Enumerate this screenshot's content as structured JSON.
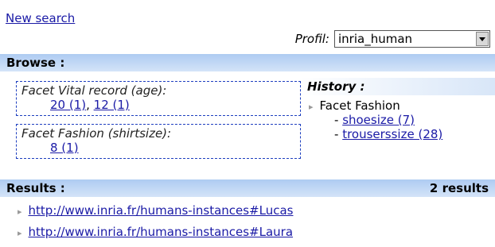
{
  "top": {
    "new_search_label": "New search",
    "profil_label": "Profil:",
    "profil_selected": "inria_human"
  },
  "browse": {
    "title": "Browse :",
    "facets": [
      {
        "title": "Facet Vital record (age):",
        "values": [
          {
            "label": "20 (1)"
          },
          {
            "label": "12 (1)"
          }
        ]
      },
      {
        "title": "Facet Fashion (shirtsize):",
        "values": [
          {
            "label": "8 (1)"
          }
        ]
      }
    ]
  },
  "history": {
    "title": "History :",
    "item_label": "Facet Fashion",
    "links": [
      {
        "label": "shoesize (7)"
      },
      {
        "label": "trouserssize (28)"
      }
    ]
  },
  "results_bar": {
    "title": "Results :",
    "count": "2 results"
  },
  "results": [
    {
      "url": "http://www.inria.fr/humans-instances#Lucas"
    },
    {
      "url": "http://www.inria.fr/humans-instances#Laura"
    }
  ],
  "colors": {
    "link": "#1a1aa6",
    "bar_top": "#aecbf2",
    "bar_bottom": "#d4e4f8",
    "facet_border": "#1e3fbf"
  }
}
